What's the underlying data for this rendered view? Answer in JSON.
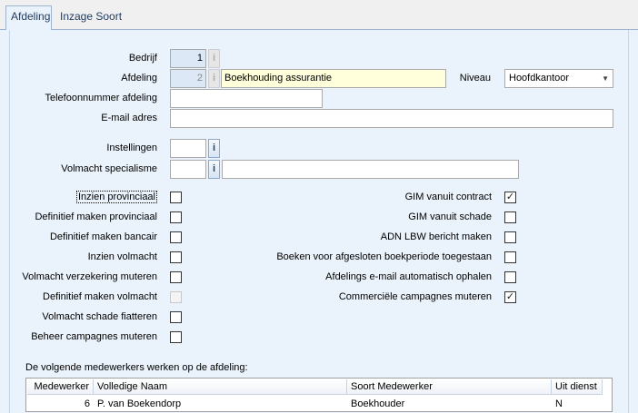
{
  "tabs": [
    {
      "label": "Afdeling",
      "active": true
    },
    {
      "label": "Inzage Soort Dossiers",
      "active": false
    }
  ],
  "form": {
    "bedrijf_label": "Bedrijf",
    "bedrijf_value": "1",
    "afdeling_label": "Afdeling",
    "afdeling_code": "2",
    "afdeling_name": "Boekhouding assurantie",
    "niveau_label": "Niveau",
    "niveau_value": "Hoofdkantoor",
    "telefoon_label": "Telefoonnummer afdeling",
    "telefoon_value": "",
    "email_label": "E-mail adres",
    "email_value": "",
    "instellingen_label": "Instellingen",
    "instellingen_value": "",
    "volmacht_spec_label": "Volmacht specialisme",
    "volmacht_spec_code": "",
    "volmacht_spec_desc": "",
    "info_glyph": "i"
  },
  "left_checks": [
    {
      "label": "Inzien provinciaal",
      "checked": false,
      "enabled": true
    },
    {
      "label": "Definitief maken provinciaal",
      "checked": false,
      "enabled": true
    },
    {
      "label": "Definitief maken bancair",
      "checked": false,
      "enabled": true
    },
    {
      "label": "Inzien volmacht",
      "checked": false,
      "enabled": true
    },
    {
      "label": "Volmacht verzekering muteren",
      "checked": false,
      "enabled": true
    },
    {
      "label": "Definitief maken volmacht",
      "checked": false,
      "enabled": false
    },
    {
      "label": "Volmacht schade fiatteren",
      "checked": false,
      "enabled": true
    },
    {
      "label": "Beheer campagnes muteren",
      "checked": false,
      "enabled": true
    }
  ],
  "right_checks": [
    {
      "label": "GIM vanuit contract",
      "checked": true
    },
    {
      "label": "GIM vanuit schade",
      "checked": false
    },
    {
      "label": "ADN LBW bericht maken",
      "checked": false
    },
    {
      "label": "Boeken voor afgesloten boekperiode toegestaan",
      "checked": false
    },
    {
      "label": "Afdelings e-mail automatisch ophalen",
      "checked": false
    },
    {
      "label": "Commerciële campagnes muteren",
      "checked": true
    }
  ],
  "employees": {
    "caption": "De volgende medewerkers werken op de afdeling:",
    "columns": [
      "Medewerker",
      "Volledige Naam",
      "Soort Medewerker",
      "Uit dienst"
    ],
    "rows": [
      {
        "medewerker": "6",
        "naam": "P. van Boekendorp",
        "soort": "Boekhouder",
        "uit_dienst": "N"
      }
    ]
  },
  "check_glyph": "✓"
}
